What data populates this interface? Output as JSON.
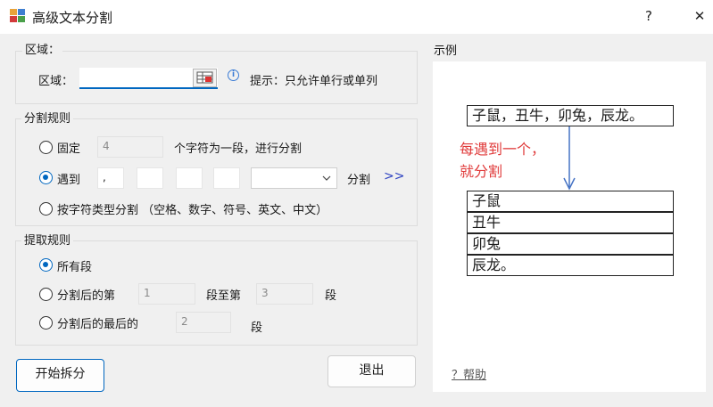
{
  "window": {
    "title": "高级文本分割",
    "help_glyph": "?",
    "close_glyph": "✕"
  },
  "region_group": {
    "title": "区域：",
    "field_label": "区域：",
    "field_value": "",
    "hint": "提示：只允许单行或单列"
  },
  "split_rules": {
    "title": "分割规则",
    "fixed": {
      "label": "固定",
      "value": "4",
      "suffix": "个字符为一段，进行分割",
      "selected": false
    },
    "encounter": {
      "label": "遇到",
      "delimiters": [
        ",",
        "",
        "",
        ""
      ],
      "dropdown_value": "",
      "suffix": "分割",
      "more": ">>",
      "selected": true
    },
    "by_type": {
      "label": "按字符类型分割 （空格、数字、符号、英文、中文）",
      "selected": false
    }
  },
  "extract_rules": {
    "title": "提取规则",
    "all": {
      "label": "所有段",
      "selected": true
    },
    "range": {
      "label_a": "分割后的第",
      "from": "1",
      "label_b": "段至第",
      "to": "3",
      "label_c": "段",
      "selected": false
    },
    "last": {
      "label_a": "分割后的最后的",
      "count": "2",
      "label_b": "段",
      "selected": false
    }
  },
  "buttons": {
    "start": "开始拆分",
    "exit": "退出"
  },
  "example": {
    "title": "示例",
    "source": "子鼠，丑牛，卯兔，辰龙。",
    "note_line1": "每遇到一个，",
    "note_line2": "就分割",
    "results": [
      "子鼠",
      "丑牛",
      "卯兔",
      "辰龙。"
    ],
    "help_link": "？帮助"
  },
  "colors": {
    "accent": "#0067c0",
    "note_red": "#e03a3a",
    "arrow_blue": "#4472c4"
  }
}
